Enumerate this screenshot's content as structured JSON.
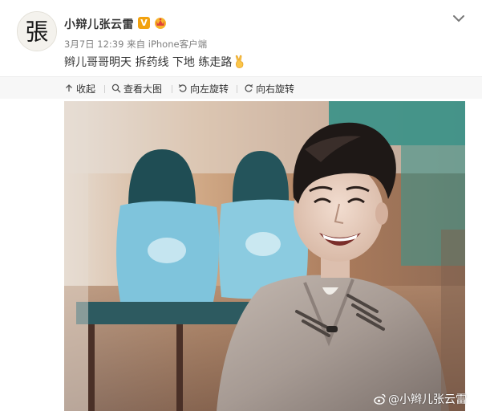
{
  "post": {
    "author": {
      "name": "小辩儿张云雷",
      "avatar_char": "張",
      "verified_badge": "V",
      "verified_color": "#f2a20f"
    },
    "meta": {
      "date": "3月7日",
      "time": "12:39",
      "source": "来自 iPhone客户端"
    },
    "content": {
      "text": "辫儿哥哥明天 拆药线 下地 练走路",
      "emoji_icon": "victory-hand-icon"
    },
    "menu_icon": "chevron-down-icon"
  },
  "toolbar": {
    "collapse_label": "收起",
    "view_large_label": "查看大图",
    "rotate_left_label": "向左旋转",
    "rotate_right_label": "向右旋转"
  },
  "photo": {
    "watermark": "@小辫儿张云雷",
    "watermark_icon": "weibo-logo-icon"
  }
}
